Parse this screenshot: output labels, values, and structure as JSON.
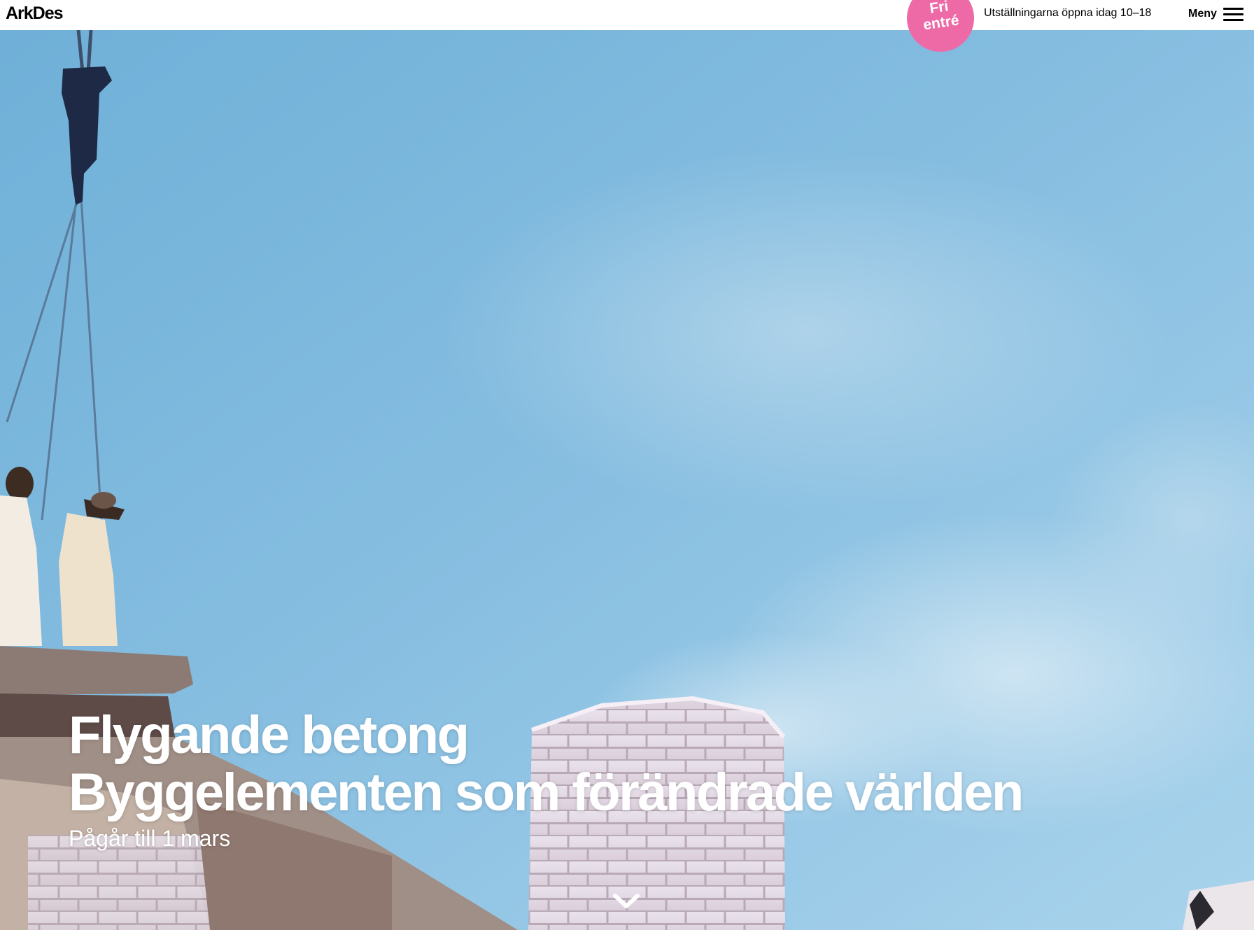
{
  "header": {
    "logo": "ArkDes",
    "badge": {
      "line1": "Fri",
      "line2": "entré",
      "color": "#ee6aa7"
    },
    "hours": "Utställningarna öppna idag 10–18",
    "menu_label": "Meny",
    "menu_icon": "hamburger-icon"
  },
  "hero": {
    "title_line1": "Flygande betong",
    "title_line2": "Byggelementen som förändrade världen",
    "subtitle": "Pågår till 1 mars",
    "scroll_icon": "chevron-down-icon",
    "sky_color": "#88bfe0"
  }
}
